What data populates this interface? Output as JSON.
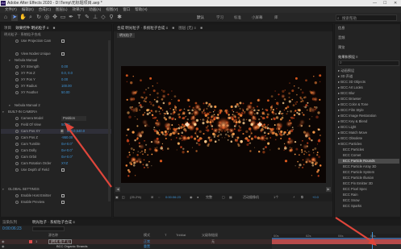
{
  "app": {
    "logo": "Ae",
    "title": "Adobe After Effects 2020 - D:\\Temp\\无标题项目.aep *",
    "window_controls": [
      "—",
      "☐",
      "✕"
    ]
  },
  "menu": [
    "文件(F)",
    "编辑(E)",
    "合成(C)",
    "图层(L)",
    "效果(T)",
    "动画(A)",
    "视图(V)",
    "窗口",
    "帮助(H)"
  ],
  "toolbar": {
    "workspaces": [
      "默认",
      "学习",
      "标准",
      "小屏幕",
      "库"
    ],
    "active_workspace": "默认",
    "search_placeholder": "搜索帮助"
  },
  "effects_panel": {
    "tabs": [
      "项目",
      "效果控件 明光粒子 ≡",
      "■"
    ],
    "header": "明光粒子 · 系统粒子合成",
    "rows": [
      {
        "label": "Use Projection Cam",
        "type": "checkbox",
        "indent": 2
      },
      {
        "label": "",
        "type": "blank",
        "indent": 0
      },
      {
        "label": "View Nodes Unique",
        "type": "checkbox",
        "indent": 2
      },
      {
        "label": "Nebula Manual",
        "type": "group",
        "indent": 1
      },
      {
        "label": "XY Strength",
        "type": "value",
        "value": "0.00",
        "indent": 2
      },
      {
        "label": "XY Pos Z",
        "type": "value",
        "value": "0.0, 0.0",
        "indent": 2
      },
      {
        "label": "XY Pos Y",
        "type": "value",
        "value": "0.00",
        "indent": 2
      },
      {
        "label": "XY Radius",
        "type": "value",
        "value": "100.00",
        "indent": 2
      },
      {
        "label": "XY Feather",
        "type": "value",
        "value": "50.00",
        "indent": 2
      },
      {
        "label": "",
        "type": "blank",
        "indent": 0
      },
      {
        "label": "Nebula Manual 2",
        "type": "group",
        "indent": 1
      },
      {
        "label": "BUILT-IN CAMERA",
        "type": "group",
        "indent": 0
      },
      {
        "label": "Camera Model",
        "type": "dropdown",
        "value": "Position",
        "indent": 2
      },
      {
        "label": "Field Of View",
        "type": "value",
        "value": "50.00",
        "indent": 2
      },
      {
        "label": "Cam Pos XY",
        "type": "value",
        "value": "960.0,540.0",
        "indent": 2,
        "highlight": true
      },
      {
        "label": "Cam Pos Z",
        "type": "value",
        "value": "-950.00",
        "indent": 2
      },
      {
        "label": "Cam Tumble",
        "type": "value",
        "value": "0x+0.0°",
        "indent": 2
      },
      {
        "label": "Cam Dolly",
        "type": "value",
        "value": "0x+0.0°",
        "indent": 2
      },
      {
        "label": "Cam Orbit",
        "type": "value",
        "value": "0x+0.0°",
        "indent": 2
      },
      {
        "label": "Cam Rotation Order",
        "type": "value",
        "value": "XYZ",
        "indent": 2
      },
      {
        "label": "Use Depth of Field",
        "type": "checkbox",
        "indent": 2
      },
      {
        "label": "",
        "type": "blank",
        "indent": 0
      },
      {
        "label": "",
        "type": "blank",
        "indent": 0
      },
      {
        "label": "GLOBAL SETTINGS",
        "type": "group",
        "indent": 0
      },
      {
        "label": "Enable Host Emitter",
        "type": "checkbox",
        "indent": 2
      },
      {
        "label": "Enable Preview",
        "type": "checkbox",
        "indent": 2
      }
    ]
  },
  "composition": {
    "tabs": [
      "合成 明光粒子 · 系统粒子合成 ≡",
      "■",
      "图层 (无) ≡",
      "■"
    ],
    "viewer_label": "明光粒子",
    "zoom": "(25.2%)",
    "timecode": "0:00:06:23",
    "quality": "完整",
    "camera": "活动摄像机",
    "view_count": "1个",
    "exposure": "+0.0"
  },
  "right_panel": {
    "sections": [
      "信息",
      "音频",
      "预览"
    ],
    "effects_title": "效果和预设 ≡",
    "search_placeholder": "",
    "items": [
      {
        "label": "▸ 动画预设",
        "indent": 0
      },
      {
        "label": "▸ 3D 声道",
        "indent": 0
      },
      {
        "label": "▸ BCC 3D Objects",
        "indent": 0
      },
      {
        "label": "▸ BCC Art Looks",
        "indent": 0
      },
      {
        "label": "▸ BCC Blur",
        "indent": 0
      },
      {
        "label": "▸ BCC Browser",
        "indent": 0
      },
      {
        "label": "▸ BCC Color & Tone",
        "indent": 0
      },
      {
        "label": "▸ BCC Film Style",
        "indent": 0
      },
      {
        "label": "▸ BCC Image Restoration",
        "indent": 0
      },
      {
        "label": "▸ BCC Key & Blend",
        "indent": 0
      },
      {
        "label": "▸ BCC Light",
        "indent": 0
      },
      {
        "label": "▸ BCC Match Move",
        "indent": 0
      },
      {
        "label": "▸ BCC Obsolete",
        "indent": 0
      },
      {
        "label": "▾ BCC Particles",
        "indent": 0
      },
      {
        "label": "BCC Particles",
        "indent": 1
      },
      {
        "label": "BCC Comet",
        "indent": 1
      },
      {
        "label": "BCC Particle Rounds",
        "indent": 1,
        "highlight": true
      },
      {
        "label": "BCC Particle Array 3D",
        "indent": 1
      },
      {
        "label": "BCC Particle System",
        "indent": 1
      },
      {
        "label": "BCC Particle Illusion",
        "indent": 1
      },
      {
        "label": "BCC Pin Emitter 3D",
        "indent": 1
      },
      {
        "label": "BCC Pixel Spec",
        "indent": 1
      },
      {
        "label": "BCC Rain",
        "indent": 1
      },
      {
        "label": "BCC Snow",
        "indent": 1
      },
      {
        "label": "BCC Sparks",
        "indent": 1
      }
    ]
  },
  "timeline": {
    "tabs": [
      "渲染队列",
      "明光粒子 · 系统粒子合成 ≡"
    ],
    "timecode": "0:00:06:23",
    "columns": [
      "源名称",
      "模式",
      "T",
      "TrkMat",
      "父级和链接"
    ],
    "layers": [
      {
        "num": "1",
        "name": "[明光 粒子 1]",
        "mode": "正常",
        "parent": "无"
      },
      {
        "num": "",
        "name": "BCC Organic Strands",
        "mode": "重置",
        "parent": ""
      },
      {
        "num": "",
        "name": "变换",
        "mode": "重置",
        "parent": ""
      }
    ],
    "ruler_labels": [
      "00s",
      "02s",
      "04s",
      "06s"
    ]
  },
  "colors": {
    "accent": "#3f95d8",
    "annotation": "#e0463b",
    "layer_bar": "#b84b4b"
  }
}
